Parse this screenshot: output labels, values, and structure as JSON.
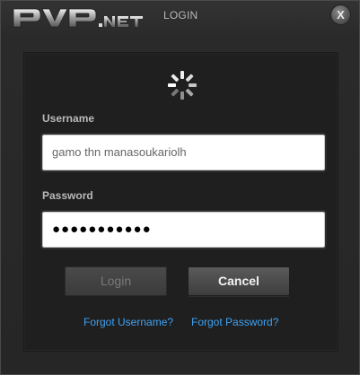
{
  "window": {
    "logo_text": "PVP.NET",
    "title": "LOGIN",
    "close_label": "X"
  },
  "form": {
    "username_label": "Username",
    "username_value": "gamo thn manasoukariolh",
    "password_label": "Password",
    "password_value": "●●●●●●●●●●●"
  },
  "buttons": {
    "login_label": "Login",
    "cancel_label": "Cancel"
  },
  "links": {
    "forgot_username": "Forgot Username?",
    "forgot_password": "Forgot Password?"
  },
  "colors": {
    "link": "#3fa2f2",
    "background": "#2b2b2b",
    "panel": "#1f1f1f"
  },
  "icons": {
    "spinner": "loading-spinner-icon",
    "close": "close-icon"
  }
}
